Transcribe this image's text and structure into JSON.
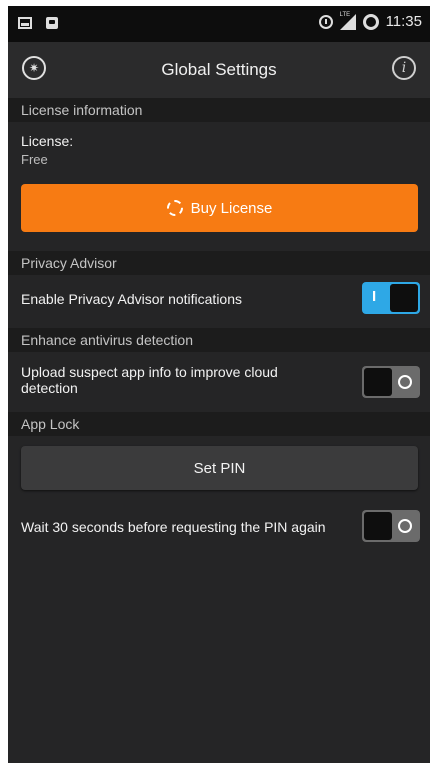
{
  "status_bar": {
    "time": "11:35",
    "network_label": "LTE",
    "left_icons": [
      "gallery-icon",
      "bag-icon"
    ],
    "right_icons": [
      "alarm-icon",
      "signal-icon",
      "battery-icon"
    ]
  },
  "app_bar": {
    "title": "Global Settings",
    "left_icon": "app-logo-icon",
    "right_icon": "info-icon",
    "info_glyph": "i"
  },
  "sections": {
    "license": {
      "header": "License information",
      "label": "License:",
      "value": "Free",
      "buy_button": "Buy License"
    },
    "privacy": {
      "header": "Privacy Advisor",
      "setting_label": "Enable Privacy Advisor notifications",
      "toggle_state": "on",
      "toggle_glyph": "I"
    },
    "antivirus": {
      "header": "Enhance antivirus detection",
      "setting_label_line1": "Upload suspect app info to improve cloud",
      "setting_label_line2": "detection",
      "toggle_state": "off"
    },
    "app_lock": {
      "header": "App Lock",
      "pin_button": "Set PIN",
      "setting_label": "Wait 30 seconds before requesting the PIN again",
      "toggle_state": "off"
    }
  },
  "colors": {
    "accent_orange": "#f77b13",
    "toggle_on": "#2ea8e6",
    "toggle_off": "#6b6b6b",
    "background": "#252526"
  }
}
